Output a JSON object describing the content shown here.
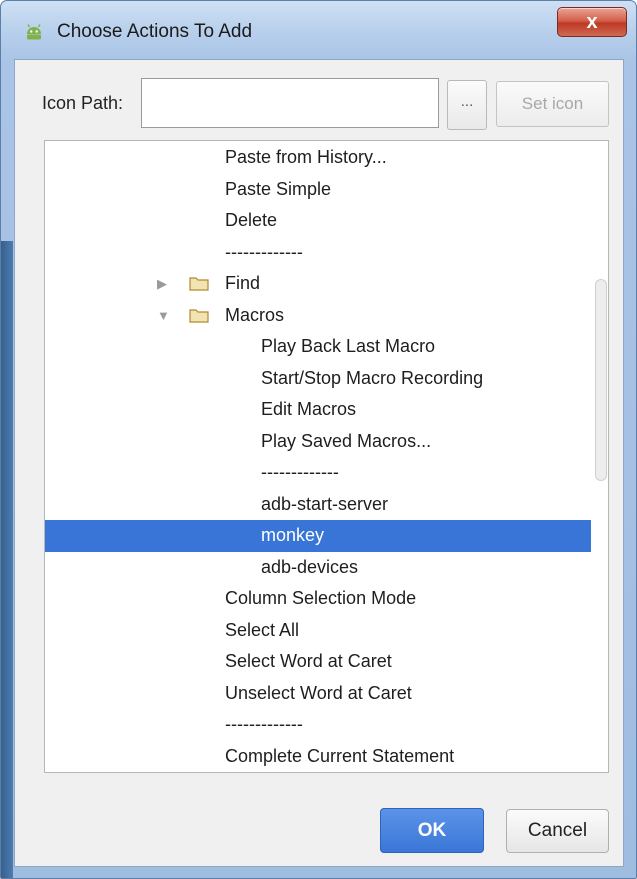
{
  "window": {
    "title": "Choose Actions To Add",
    "close_label": "x",
    "app_icon": "android-robot-icon"
  },
  "icon_path": {
    "label": "Icon Path:",
    "value": "",
    "browse_label": "...",
    "set_icon_label": "Set icon"
  },
  "tree": {
    "rows": [
      {
        "label": "Paste from History...",
        "level": 1
      },
      {
        "label": "Paste Simple",
        "level": 1
      },
      {
        "label": "Delete",
        "level": 1
      },
      {
        "label": "-------------",
        "level": 1
      },
      {
        "label": "Find",
        "level": 1,
        "folder": true,
        "expanded": false
      },
      {
        "label": "Macros",
        "level": 1,
        "folder": true,
        "expanded": true
      },
      {
        "label": "Play Back Last Macro",
        "level": 2
      },
      {
        "label": "Start/Stop Macro Recording",
        "level": 2
      },
      {
        "label": "Edit Macros",
        "level": 2
      },
      {
        "label": "Play Saved Macros...",
        "level": 2
      },
      {
        "label": "-------------",
        "level": 2
      },
      {
        "label": "adb-start-server",
        "level": 2
      },
      {
        "label": "monkey",
        "level": 2,
        "selected": true
      },
      {
        "label": "adb-devices",
        "level": 2
      },
      {
        "label": "Column Selection Mode",
        "level": 1
      },
      {
        "label": "Select All",
        "level": 1
      },
      {
        "label": "Select Word at Caret",
        "level": 1
      },
      {
        "label": "Unselect Word at Caret",
        "level": 1
      },
      {
        "label": "-------------",
        "level": 1
      },
      {
        "label": "Complete Current Statement",
        "level": 1
      }
    ]
  },
  "buttons": {
    "ok": "OK",
    "cancel": "Cancel"
  },
  "colors": {
    "selection": "#3875d7",
    "ok_button": "#4a86e0",
    "close_button": "#c9503c"
  }
}
